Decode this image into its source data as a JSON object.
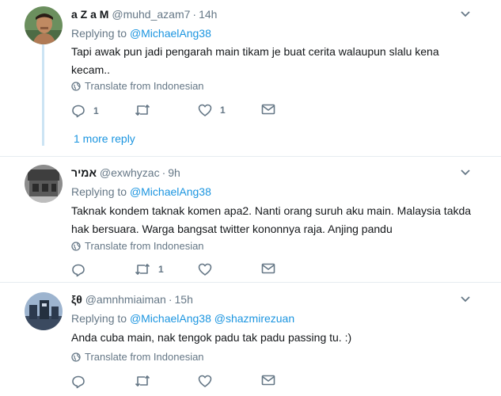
{
  "tweets": [
    {
      "name": "a Z a M",
      "handle": "@muhd_azam7",
      "time": "14h",
      "replying_label": "Replying to",
      "replying_to": [
        "@MichaelAng38"
      ],
      "text": "Tapi awak pun jadi pengarah main tikam je buat cerita walaupun slalu kena kecam..",
      "translate_label": "Translate from Indonesian",
      "reply_count": "1",
      "retweet_count": "",
      "like_count": "1",
      "more_replies": "1 more reply"
    },
    {
      "name": "אמיר",
      "handle": "@exwhyzac",
      "time": "9h",
      "replying_label": "Replying to",
      "replying_to": [
        "@MichaelAng38"
      ],
      "text": "Taknak kondem taknak komen apa2. Nanti orang suruh aku main. Malaysia takda hak bersuara. Warga bangsat twitter kononnya raja. Anjing pandu",
      "translate_label": "Translate from Indonesian",
      "reply_count": "",
      "retweet_count": "1",
      "like_count": ""
    },
    {
      "name": "ξθ",
      "handle": "@amnhmiaiman",
      "time": "15h",
      "replying_label": "Replying to",
      "replying_to": [
        "@MichaelAng38",
        "@shazmirezuan"
      ],
      "text": "Anda cuba main, nak tengok padu tak padu passing tu. :)",
      "translate_label": "Translate from Indonesian",
      "reply_count": "",
      "retweet_count": "",
      "like_count": ""
    }
  ],
  "colors": {
    "link": "#1b95e0",
    "secondary": "#657786",
    "thread_line": "#cce4f4",
    "divider": "#e6ecf0"
  },
  "icons": [
    "globe-icon",
    "reply-icon",
    "retweet-icon",
    "like-icon",
    "message-icon",
    "chevron-down-icon"
  ]
}
